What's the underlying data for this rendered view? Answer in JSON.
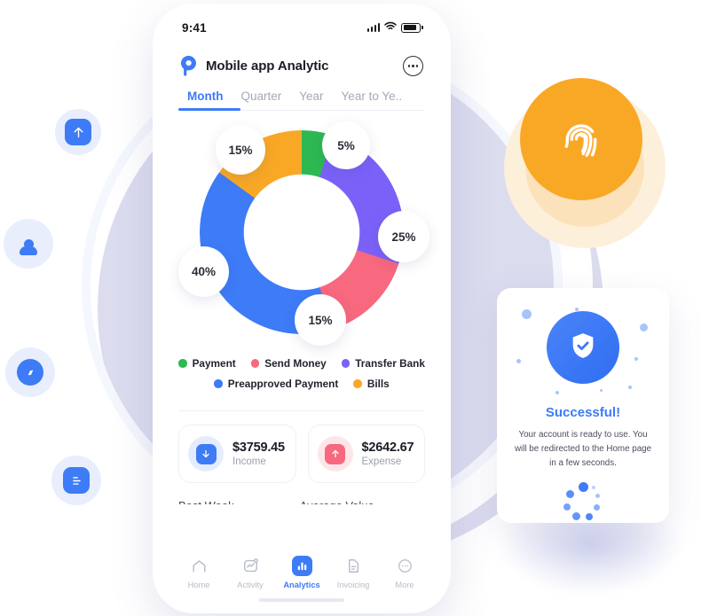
{
  "phone": {
    "status_bar": {
      "time": "9:41",
      "signal": "signal-bars",
      "wifi": "wifi-icon",
      "battery": "battery-icon"
    },
    "header": {
      "logo": "app-logo",
      "title": "Mobile app Analytic",
      "more": "more-options-icon"
    },
    "tabs": [
      {
        "label": "Month",
        "active": true
      },
      {
        "label": "Quarter",
        "active": false
      },
      {
        "label": "Year",
        "active": false
      },
      {
        "label": "Year to Ye..",
        "active": false
      }
    ],
    "legend": [
      {
        "label": "Payment",
        "color": "#2eb852"
      },
      {
        "label": "Send Money",
        "color": "#f8687e"
      },
      {
        "label": "Transfer Bank",
        "color": "#7b61f8"
      },
      {
        "label": "Preapproved Payment",
        "color": "#3d7bf7"
      },
      {
        "label": "Bills",
        "color": "#f9a826"
      }
    ],
    "stats": [
      {
        "value": "$3759.45",
        "label": "Income",
        "icon": "arrow-down-icon",
        "color": "#3d7bf7",
        "halo": "#e4ecfd"
      },
      {
        "value": "$2642.67",
        "label": "Expense",
        "icon": "arrow-up-icon",
        "color": "#f8687e",
        "halo": "#fde6e9"
      }
    ],
    "clipped_row": [
      "Best Week",
      "Average Value"
    ],
    "bottom_nav": [
      {
        "label": "Home",
        "icon": "home-icon",
        "active": false
      },
      {
        "label": "Activity",
        "icon": "activity-icon",
        "active": false
      },
      {
        "label": "Analytics",
        "icon": "analytics-icon",
        "active": true
      },
      {
        "label": "Invoicing",
        "icon": "invoice-icon",
        "active": false
      },
      {
        "label": "More",
        "icon": "more-icon",
        "active": false
      }
    ]
  },
  "chart_data": {
    "type": "pie",
    "title": "Mobile app Analytic",
    "categories": [
      "Payment",
      "Transfer Bank",
      "Send Money",
      "Preapproved Payment",
      "Bills"
    ],
    "values": [
      5,
      25,
      15,
      40,
      15
    ],
    "labels": [
      "5%",
      "25%",
      "15%",
      "40%",
      "15%"
    ],
    "colors": [
      "#2eb852",
      "#7b61f8",
      "#f8687e",
      "#3d7bf7",
      "#f9a826"
    ],
    "unit": "%",
    "legend_position": "bottom",
    "donut": true
  },
  "success_card": {
    "badge": "shield-check-icon",
    "title": "Successful!",
    "message": "Your account is ready to use. You will be redirected to the Home page in a few seconds.",
    "loader": "loading-spinner"
  },
  "floating_icons": [
    {
      "name": "upload-icon",
      "color": "#3d7bf7"
    },
    {
      "name": "person-icon",
      "color": "#3d7bf7"
    },
    {
      "name": "compass-icon",
      "color": "#3d7bf7"
    },
    {
      "name": "document-icon",
      "color": "#3d7bf7"
    }
  ],
  "fingerprint_badge": {
    "icon": "fingerprint-icon",
    "color": "#f9a826"
  },
  "colors": {
    "accent": "#3d7bf7",
    "lavender": "#dcdcef",
    "orange": "#f9a826",
    "green": "#2eb852",
    "purple": "#7b61f8",
    "pink": "#f8687e"
  }
}
